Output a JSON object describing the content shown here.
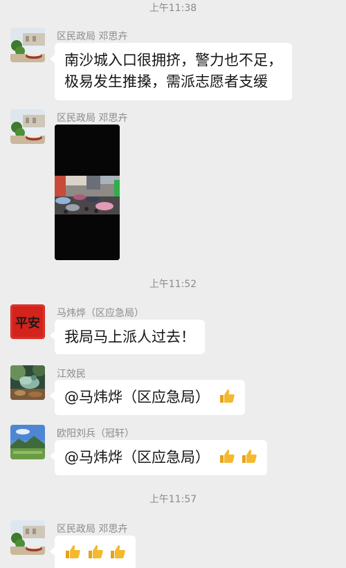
{
  "timestamps": [
    "上午11:38",
    "上午11:52",
    "上午11:57"
  ],
  "messages": [
    {
      "sender": "区民政局 邓思卉",
      "avatar": "garden-courtyard-avatar",
      "lines": [
        "南沙城入口很拥挤，警力也不足，",
        "极易发生推搡，需派志愿者支缓"
      ]
    },
    {
      "sender": "区民政局 邓思卉",
      "avatar": "garden-courtyard-avatar",
      "media": "crowd-street-video-thumbnail"
    },
    {
      "sender": "马炜烨（区应急局）",
      "avatar": "ping-an-red-avatar",
      "avatar_text": "平安",
      "text": "我局马上派人过去！"
    },
    {
      "sender": "江效民",
      "avatar": "pigeon-avatar",
      "text": "@马炜烨（区应急局）",
      "thumbs": 1
    },
    {
      "sender": "欧阳刘兵（冠轩）",
      "avatar": "landscape-avatar",
      "text": "@马炜烨（区应急局）",
      "thumbs": 2
    },
    {
      "sender": "区民政局 邓思卉",
      "avatar": "garden-courtyard-avatar",
      "thumbs": 3
    }
  ],
  "colors": {
    "background": "#ededed",
    "bubble": "#ffffff",
    "thumb": "#f5b82e"
  },
  "icons": [
    "thumbs-up-icon"
  ]
}
